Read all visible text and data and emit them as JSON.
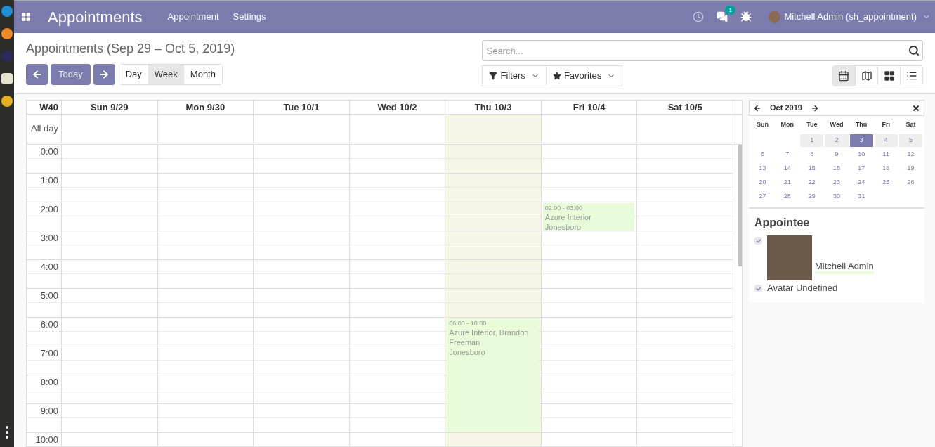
{
  "topbar": {
    "app_title": "Appointments",
    "menu": [
      "Appointment",
      "Settings"
    ],
    "messages_badge": "1",
    "user": "Mitchell Admin (sh_appointment)"
  },
  "control_panel": {
    "breadcrumb": "Appointments (Sep 29 – Oct 5, 2019)",
    "today_button": "Today",
    "scales": [
      {
        "label": "Day",
        "selected": false
      },
      {
        "label": "Week",
        "selected": true
      },
      {
        "label": "Month",
        "selected": false
      }
    ],
    "search": {
      "placeholder": "Search..."
    },
    "filters": "Filters",
    "favorites": "Favorites",
    "views": [
      {
        "kind": "calendar",
        "selected": true
      },
      {
        "kind": "map",
        "selected": false
      },
      {
        "kind": "kanban",
        "selected": false
      },
      {
        "kind": "list",
        "selected": false
      }
    ]
  },
  "calendar": {
    "week_label": "W40",
    "all_day_label": "All day",
    "columns": [
      {
        "label": "Sun 9/29",
        "today": false
      },
      {
        "label": "Mon 9/30",
        "today": false
      },
      {
        "label": "Tue 10/1",
        "today": false
      },
      {
        "label": "Wed 10/2",
        "today": false
      },
      {
        "label": "Thu 10/3",
        "today": true,
        "events": [
          {
            "time": "06:00 - 10:00",
            "title": "Azure Interior, Brandon Freeman",
            "location": "Jonesboro"
          }
        ]
      },
      {
        "label": "Fri 10/4",
        "today": false,
        "events": [
          {
            "time": "02:00 - 03:00",
            "title": "Azure Interior",
            "location": "Jonesboro"
          }
        ]
      },
      {
        "label": "Sat 10/5",
        "today": false
      }
    ],
    "hours": [
      "0:00",
      "1:00",
      "2:00",
      "3:00",
      "4:00",
      "5:00",
      "6:00",
      "7:00",
      "8:00",
      "9:00",
      "10:00"
    ]
  },
  "mini_calendar": {
    "month": "Oct 2019",
    "weekdays": [
      "Sun",
      "Mon",
      "Tue",
      "Wed",
      "Thu",
      "Fri",
      "Sat"
    ],
    "weeks": [
      [
        {
          "day": "1",
          "in_range": true,
          "selected": false
        },
        {
          "day": "2",
          "in_range": true,
          "selected": false
        },
        {
          "day": "3",
          "in_range": true,
          "selected": true
        },
        {
          "day": "4",
          "in_range": true,
          "selected": false
        },
        {
          "day": "5",
          "in_range": true,
          "selected": false
        }
      ],
      [
        {
          "day": "6",
          "in_range": false,
          "selected": false
        },
        {
          "day": "7",
          "in_range": false,
          "selected": false
        },
        {
          "day": "8",
          "in_range": false,
          "selected": false
        },
        {
          "day": "9",
          "in_range": false,
          "selected": false
        },
        {
          "day": "10",
          "in_range": false,
          "selected": false
        },
        {
          "day": "11",
          "in_range": false,
          "selected": false
        },
        {
          "day": "12",
          "in_range": false,
          "selected": false
        }
      ],
      [
        {
          "day": "13",
          "in_range": false,
          "selected": false
        },
        {
          "day": "14",
          "in_range": false,
          "selected": false
        },
        {
          "day": "15",
          "in_range": false,
          "selected": false
        },
        {
          "day": "16",
          "in_range": false,
          "selected": false
        },
        {
          "day": "17",
          "in_range": false,
          "selected": false
        },
        {
          "day": "18",
          "in_range": false,
          "selected": false
        },
        {
          "day": "19",
          "in_range": false,
          "selected": false
        }
      ],
      [
        {
          "day": "20",
          "in_range": false,
          "selected": false
        },
        {
          "day": "21",
          "in_range": false,
          "selected": false
        },
        {
          "day": "22",
          "in_range": false,
          "selected": false
        },
        {
          "day": "23",
          "in_range": false,
          "selected": false
        },
        {
          "day": "24",
          "in_range": false,
          "selected": false
        },
        {
          "day": "25",
          "in_range": false,
          "selected": false
        },
        {
          "day": "26",
          "in_range": false,
          "selected": false
        }
      ],
      [
        {
          "day": "27",
          "in_range": false,
          "selected": false
        },
        {
          "day": "28",
          "in_range": false,
          "selected": false
        },
        {
          "day": "29",
          "in_range": false,
          "selected": false
        },
        {
          "day": "30",
          "in_range": false,
          "selected": false
        },
        {
          "day": "31",
          "in_range": false,
          "selected": false
        }
      ]
    ]
  },
  "appointee": {
    "title": "Appointee",
    "items": [
      {
        "kind": "avatar",
        "name": "Mitchell Admin",
        "checked": true
      },
      {
        "kind": "plain",
        "name": "Avatar Undefined",
        "checked": true
      }
    ]
  }
}
